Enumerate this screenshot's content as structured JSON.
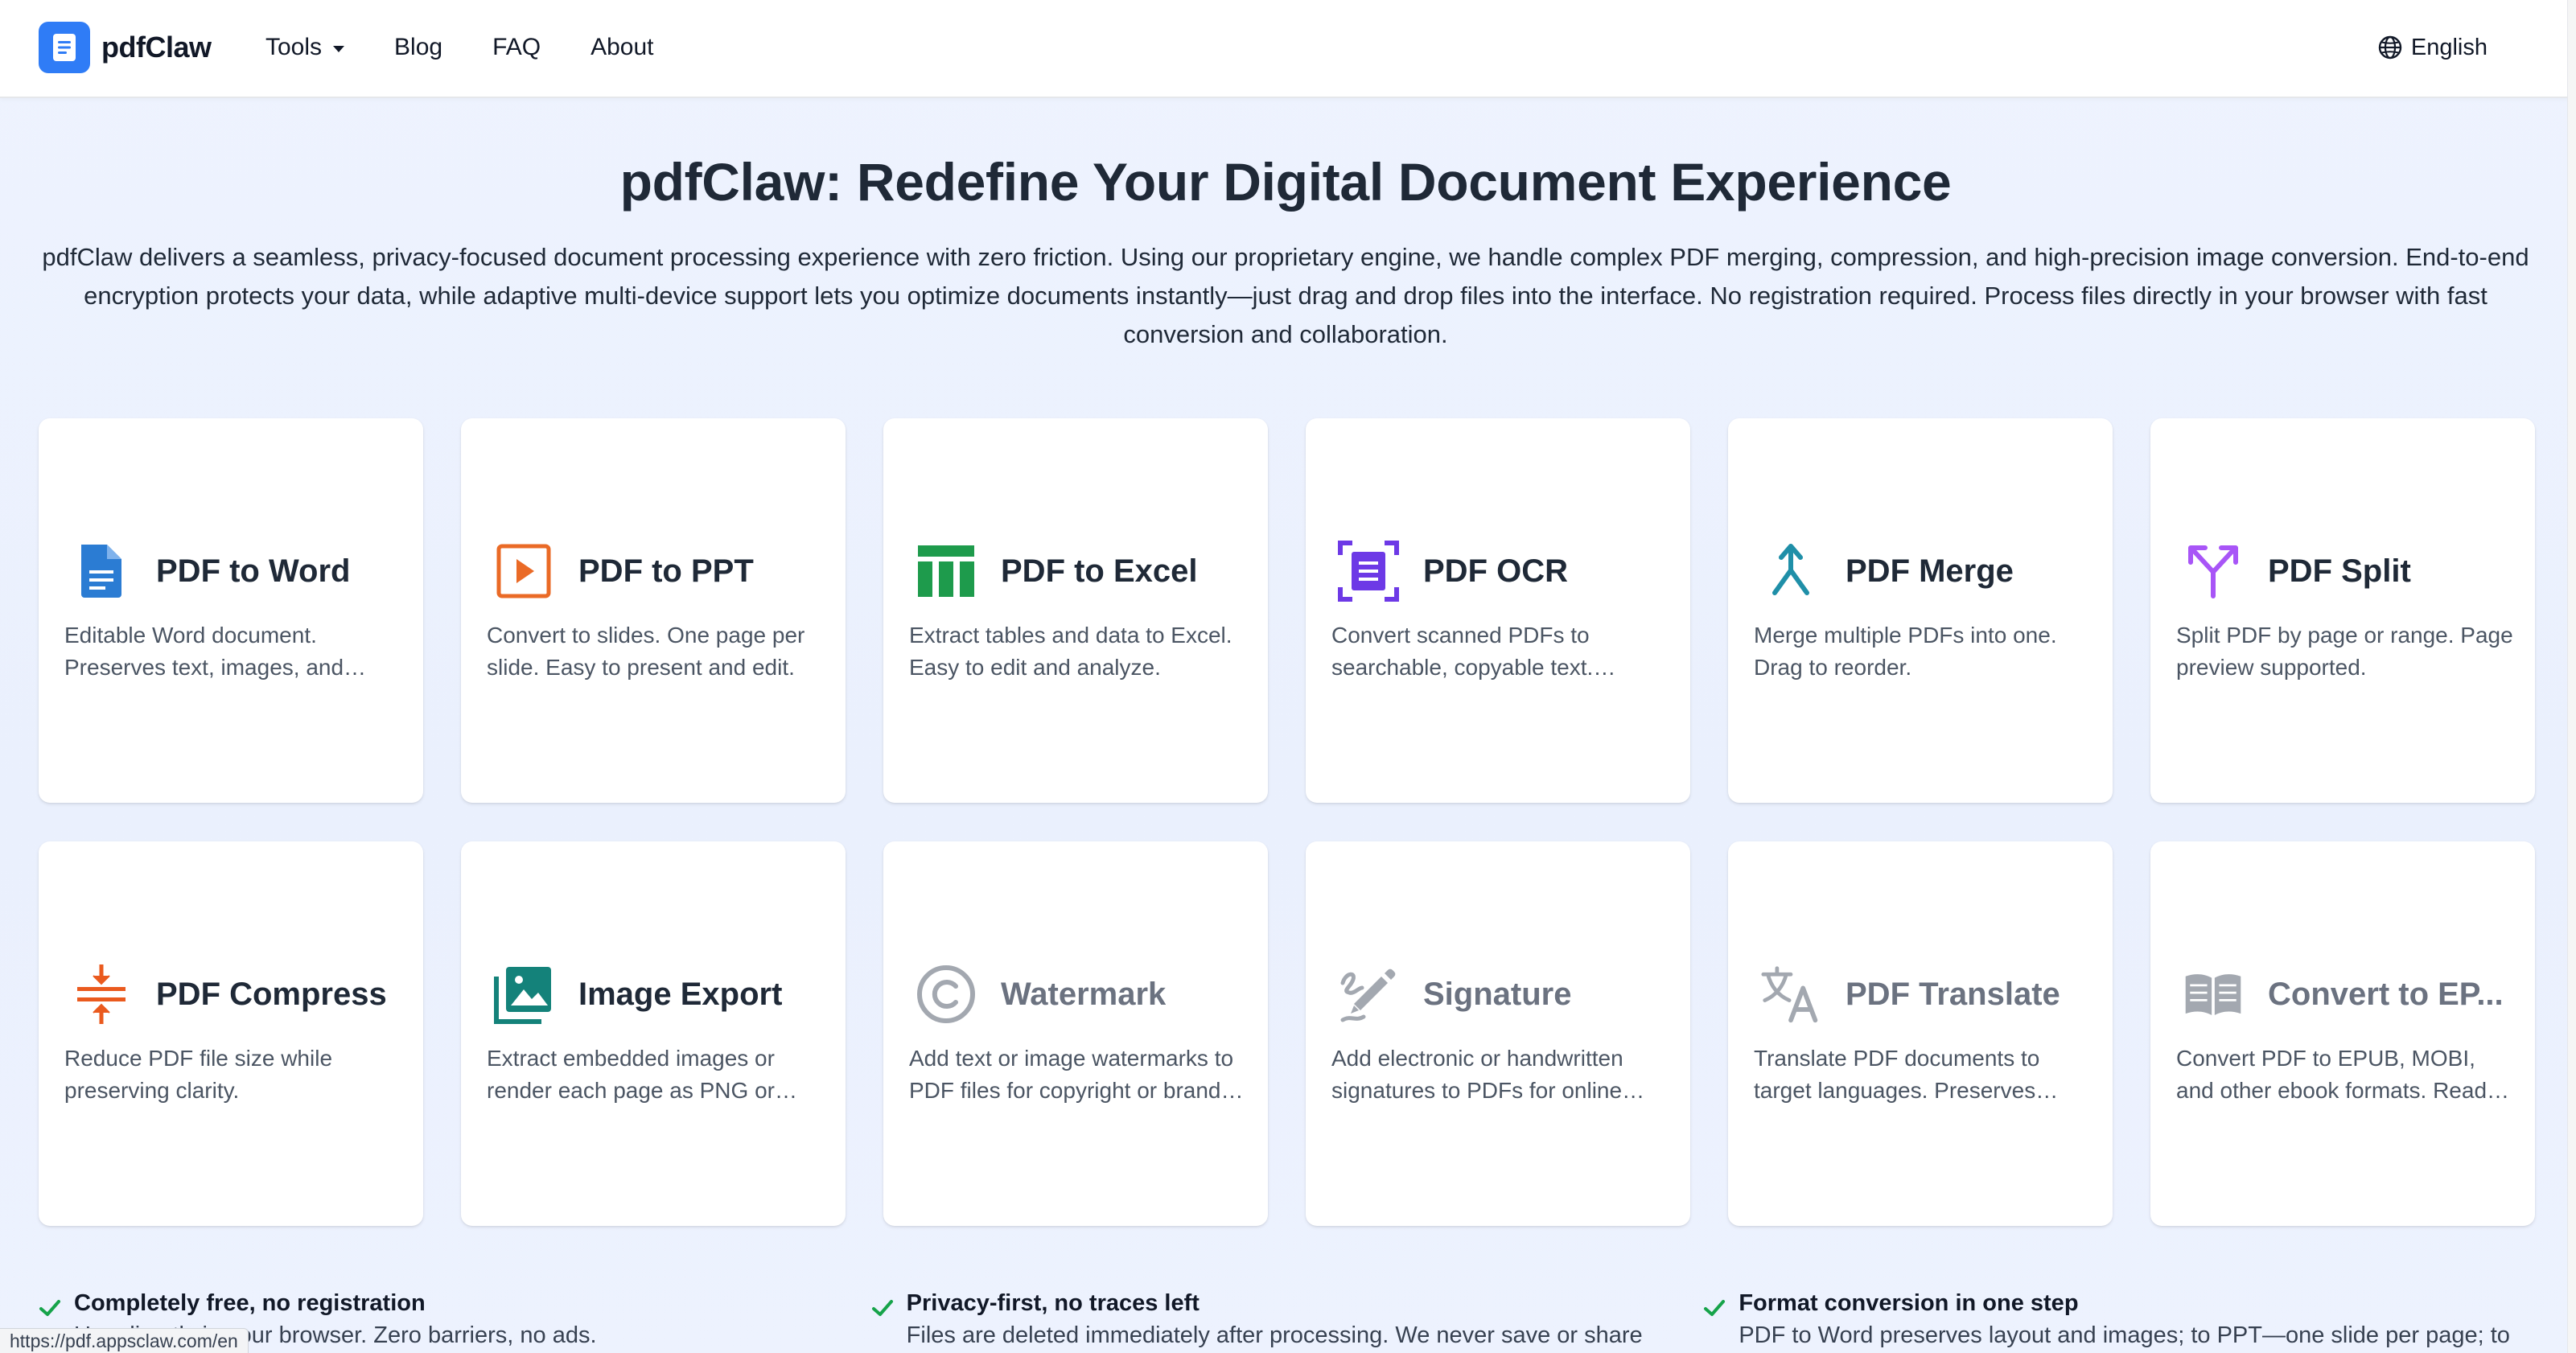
{
  "nav": {
    "logo": "pdfClaw",
    "links": [
      "Tools",
      "Blog",
      "FAQ",
      "About"
    ],
    "language": "English"
  },
  "hero": {
    "title": "pdfClaw: Redefine Your Digital Document Experience",
    "description": "pdfClaw delivers a seamless, privacy-focused document processing experience with zero friction. Using our proprietary engine, we handle complex PDF merging, compression, and high-precision image conversion. End-to-end encryption protects your data, while adaptive multi-device support lets you optimize documents instantly—just drag and drop files into the interface. No registration required. Process files directly in your browser with fast conversion and collaboration."
  },
  "tools": [
    {
      "title": "PDF to Word",
      "desc": "Editable Word document. Preserves text, images, and layout.",
      "icon": "word-doc-icon",
      "color": "#2b7cd3"
    },
    {
      "title": "PDF to PPT",
      "desc": "Convert to slides. One page per slide. Easy to present and edit.",
      "icon": "slides-play-icon",
      "color": "#ea6a26"
    },
    {
      "title": "PDF to Excel",
      "desc": "Extract tables and data to Excel. Easy to edit and analyze.",
      "icon": "table-icon",
      "color": "#1e9b4c"
    },
    {
      "title": "PDF OCR",
      "desc": "Convert scanned PDFs to searchable, copyable text. Supports multiple languages.",
      "icon": "document-scan-icon",
      "color": "#6d39e6"
    },
    {
      "title": "PDF Merge",
      "desc": "Merge multiple PDFs into one. Drag to reorder.",
      "icon": "merge-icon",
      "color": "#1f8fa8"
    },
    {
      "title": "PDF Split",
      "desc": "Split PDF by page or range. Page preview supported.",
      "icon": "split-icon",
      "color": "#a855f7"
    },
    {
      "title": "PDF Compress",
      "desc": "Reduce PDF file size while preserving clarity.",
      "icon": "compress-icon",
      "color": "#ea5a1e"
    },
    {
      "title": "Image Export",
      "desc": "Extract embedded images or render each page as PNG or JPG.",
      "icon": "image-gallery-icon",
      "color": "#14827a"
    },
    {
      "title": "Watermark",
      "desc": "Add text or image watermarks to PDF files for copyright or brand protection.",
      "icon": "copyright-icon",
      "color": "#a3a8b0"
    },
    {
      "title": "Signature",
      "desc": "Add electronic or handwritten signatures to PDFs for online signing.",
      "icon": "signature-pen-icon",
      "color": "#a3a8b0"
    },
    {
      "title": "PDF Translate",
      "desc": "Translate PDF documents to target languages. Preserves original layout.",
      "icon": "translate-icon",
      "color": "#a3a8b0"
    },
    {
      "title": "Convert to EP...",
      "desc": "Convert PDF to EPUB, MOBI, and other ebook formats. Read on any device.",
      "icon": "open-book-icon",
      "color": "#a3a8b0"
    }
  ],
  "features": [
    {
      "title": "Completely free, no registration",
      "text": "Use directly in your browser. Zero barriers, no ads."
    },
    {
      "title": "Privacy-first, no traces left",
      "text": "Files are deleted immediately after processing. We never save or share"
    },
    {
      "title": "Format conversion in one step",
      "text": "PDF to Word preserves layout and images; to PPT—one slide per page; to"
    }
  ],
  "status_url": "https://pdf.appsclaw.com/en"
}
